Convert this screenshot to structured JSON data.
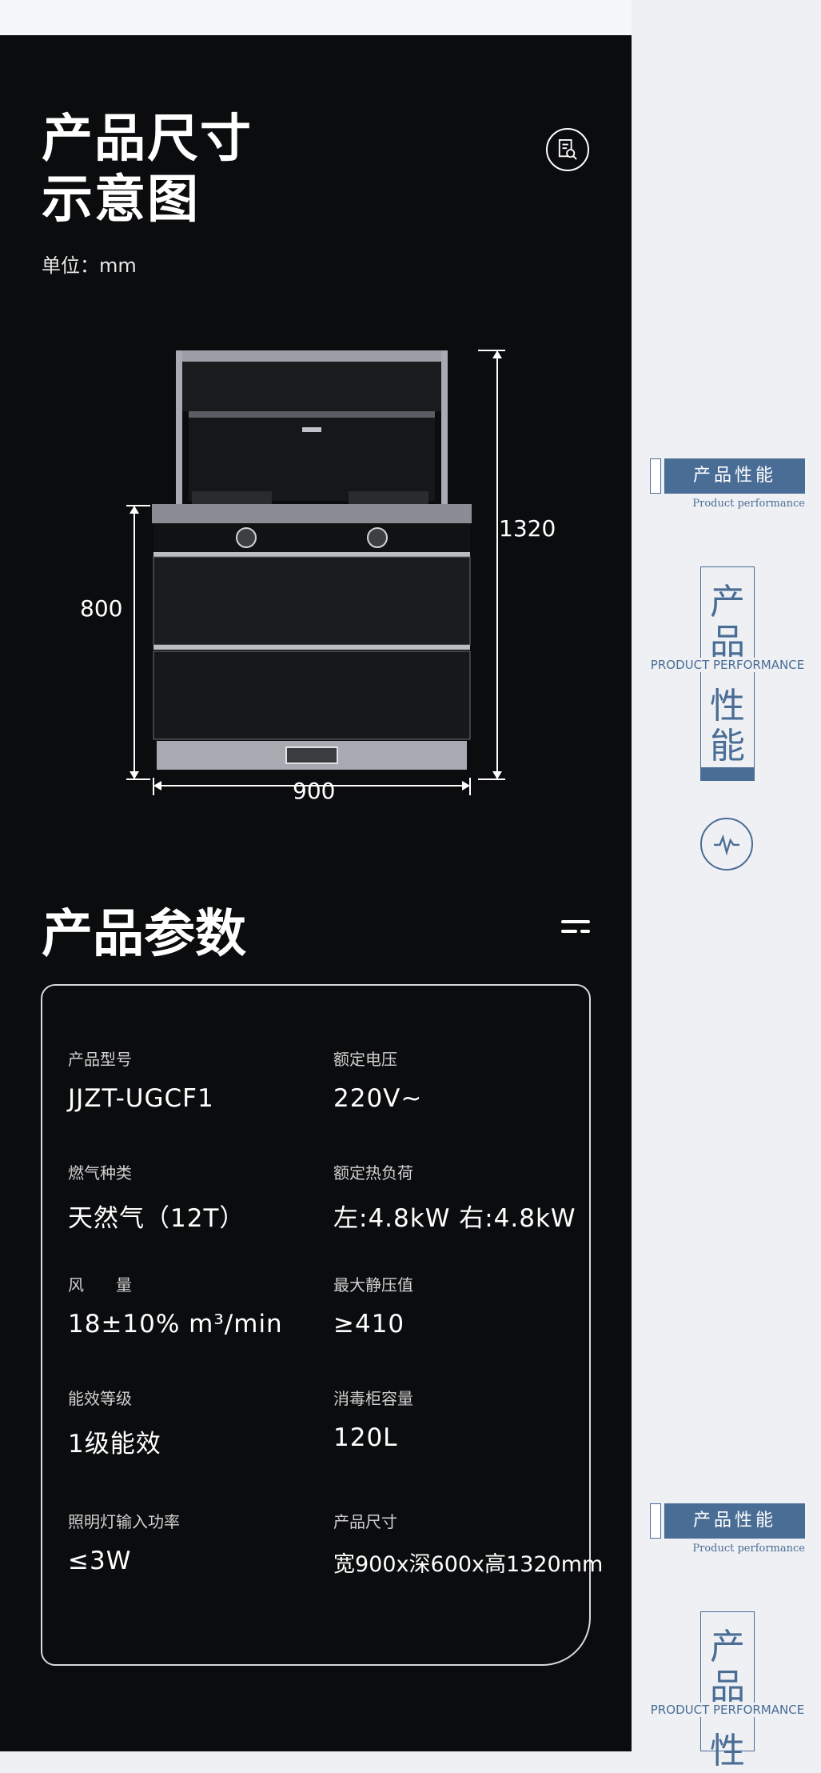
{
  "dimension_section": {
    "title_line1": "产品尺寸",
    "title_line2": "示意图",
    "unit": "单位：mm",
    "height_label": "1320",
    "base_height_label": "800",
    "width_label": "900"
  },
  "params_section": {
    "title": "产品参数",
    "specs": [
      {
        "label": "产品型号",
        "value": "JJZT-UGCF1"
      },
      {
        "label": "额定电压",
        "value": "220V~"
      },
      {
        "label": "燃气种类",
        "value": "天然气（12T）"
      },
      {
        "label": "额定热负荷",
        "value": "左:4.8kW  右:4.8kW"
      },
      {
        "label": "风　　量",
        "value": "18±10% m³/min"
      },
      {
        "label": "最大静压值",
        "value": "≥410"
      },
      {
        "label": "能效等级",
        "value": "1级能效"
      },
      {
        "label": "消毒柜容量",
        "value": "120L"
      },
      {
        "label": "照明灯输入功率",
        "value": "≤3W"
      },
      {
        "label": "产品尺寸",
        "value": "宽900x深600x高1320mm"
      }
    ]
  },
  "side": {
    "badge_cn": "产品性能",
    "badge_en": "Product performance",
    "vertical_chars": [
      "产",
      "品",
      "性",
      "能"
    ],
    "vertical_en": "PRODUCT PERFORMANCE"
  },
  "colors": {
    "dark_bg": "#0b0c0e",
    "accent_blue": "#4a6d96",
    "side_bg": "#eef0f4"
  },
  "icons": [
    "document-search-icon",
    "equalizer-icon",
    "pulse-icon"
  ]
}
